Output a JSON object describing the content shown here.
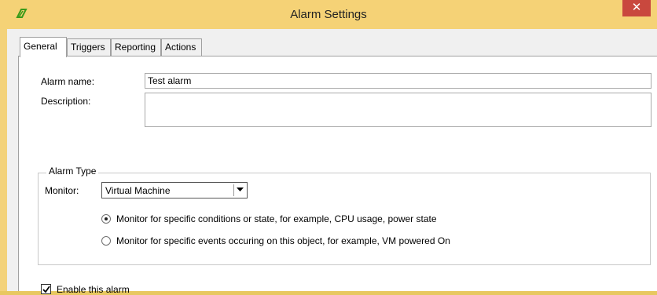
{
  "window": {
    "title": "Alarm Settings",
    "close_glyph": "✕",
    "colors": {
      "titlebar": "#f5d276",
      "close": "#c9483e",
      "accent_green": "#3a9a1a"
    }
  },
  "tabs": [
    {
      "label": "General",
      "active": true
    },
    {
      "label": "Triggers",
      "active": false
    },
    {
      "label": "Reporting",
      "active": false
    },
    {
      "label": "Actions",
      "active": false
    }
  ],
  "form": {
    "alarm_name_label": "Alarm name:",
    "alarm_name_value": "Test alarm",
    "description_label": "Description:",
    "description_value": ""
  },
  "alarm_type": {
    "legend": "Alarm Type",
    "monitor_label": "Monitor:",
    "monitor_value": "Virtual Machine",
    "options": [
      {
        "label": "Monitor for specific conditions or state, for example, CPU usage, power state",
        "selected": true
      },
      {
        "label": "Monitor for specific events occuring on this object, for example, VM powered On",
        "selected": false
      }
    ]
  },
  "enable": {
    "label": "Enable this alarm",
    "checked": true
  },
  "icons": {
    "app": "alarm-app-icon",
    "close": "close-icon",
    "dropdown": "chevron-down-icon",
    "check": "checkmark-icon"
  }
}
